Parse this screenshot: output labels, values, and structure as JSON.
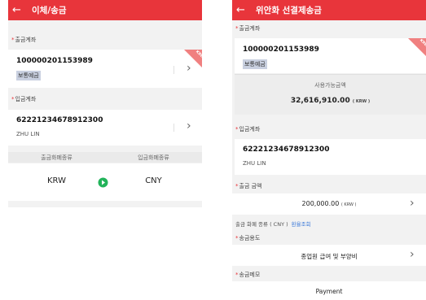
{
  "screen1": {
    "title": "이체/송금",
    "withdraw_label": "출금계좌",
    "withdraw_account": "100000201153989",
    "withdraw_type": "보통예금",
    "ribbon": "KRW",
    "deposit_label": "입금계좌",
    "deposit_account": "62221234678912300",
    "deposit_name": "ZHU LIN",
    "from_currency_label": "출금화폐종류",
    "to_currency_label": "입금화폐종류",
    "from_currency": "KRW",
    "to_currency": "CNY"
  },
  "screen2": {
    "title": "위안화 선결제송금",
    "withdraw_label": "출금계좌",
    "withdraw_account": "100000201153989",
    "withdraw_type": "보통예금",
    "ribbon": "KRW",
    "balance_label": "사용가능금액",
    "balance_value": "32,616,910.00",
    "balance_unit": "( KRW )",
    "deposit_label": "입금계좌",
    "deposit_account": "62221234678912300",
    "deposit_name": "ZHU LIN",
    "amount_label": "출금 금액",
    "amount_value": "200,000.00",
    "amount_unit": "( KRW )",
    "currency_note": "출금 화폐 종류 ( CNY )",
    "rate_link": "환율조회",
    "purpose_label": "송금용도",
    "purpose_value": "종업원 급여 및 부양비",
    "memo_label": "송금메모",
    "memo_value": "Payment"
  },
  "colors": {
    "header": "#e8353b",
    "required_mark": "#e8353b",
    "swap_icon": "#22b35a",
    "link": "#3d7bd9"
  }
}
